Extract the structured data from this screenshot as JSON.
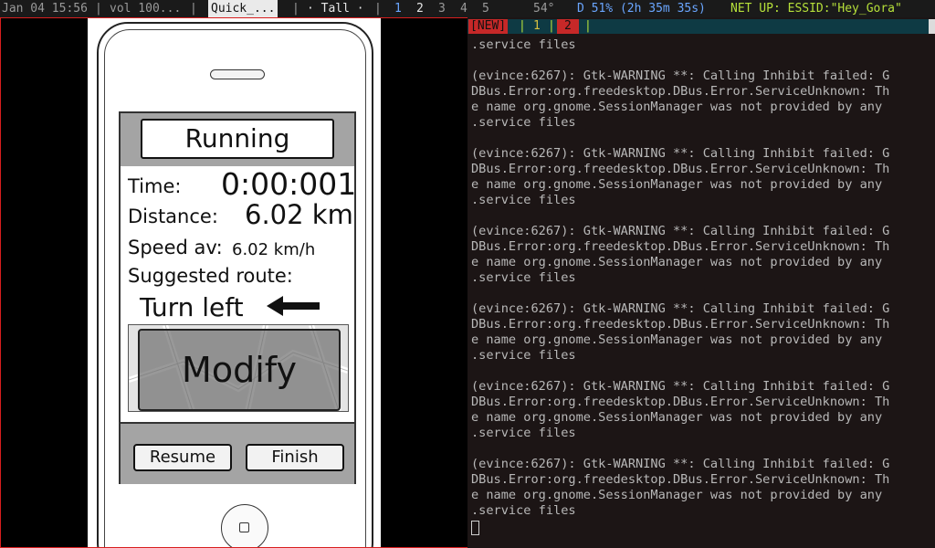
{
  "topbar": {
    "datetime": "Jan 04 15:56",
    "sep_a": "|",
    "volume": "vol 100...",
    "sep_b": "|",
    "active_title": "Quick_...",
    "sep_c": "|",
    "layout": "· Tall ·",
    "sep_d": "|",
    "workspaces": [
      "1",
      "2",
      "3",
      "4",
      "5"
    ],
    "temperature": "54°",
    "battery": "D 51% (2h 35m 35s)",
    "network": "NET UP: ESSID:\"Hey_Gora\""
  },
  "mockup": {
    "status_title": "Running",
    "time_label": "Time:",
    "time_value": "0:00:001",
    "distance_label": "Distance:",
    "distance_value": "6.02 km",
    "speed_label": "Speed av:",
    "speed_value": "6.02 km/h",
    "route_label": "Suggested route:",
    "route_instruction": "Turn left",
    "modify_label": "Modify",
    "resume_label": "Resume",
    "finish_label": "Finish"
  },
  "terminal": {
    "tabs": [
      "[NEW]",
      "1",
      "2"
    ],
    "separators": [
      "|",
      "|",
      "|"
    ],
    "lines": [
      ".service files",
      "",
      "(evince:6267): Gtk-WARNING **: Calling Inhibit failed: G",
      "DBus.Error:org.freedesktop.DBus.Error.ServiceUnknown: Th",
      "e name org.gnome.SessionManager was not provided by any",
      ".service files",
      "",
      "(evince:6267): Gtk-WARNING **: Calling Inhibit failed: G",
      "DBus.Error:org.freedesktop.DBus.Error.ServiceUnknown: Th",
      "e name org.gnome.SessionManager was not provided by any",
      ".service files",
      "",
      "(evince:6267): Gtk-WARNING **: Calling Inhibit failed: G",
      "DBus.Error:org.freedesktop.DBus.Error.ServiceUnknown: Th",
      "e name org.gnome.SessionManager was not provided by any",
      ".service files",
      "",
      "(evince:6267): Gtk-WARNING **: Calling Inhibit failed: G",
      "DBus.Error:org.freedesktop.DBus.Error.ServiceUnknown: Th",
      "e name org.gnome.SessionManager was not provided by any",
      ".service files",
      "",
      "(evince:6267): Gtk-WARNING **: Calling Inhibit failed: G",
      "DBus.Error:org.freedesktop.DBus.Error.ServiceUnknown: Th",
      "e name org.gnome.SessionManager was not provided by any",
      ".service files",
      "",
      "(evince:6267): Gtk-WARNING **: Calling Inhibit failed: G",
      "DBus.Error:org.freedesktop.DBus.Error.ServiceUnknown: Th",
      "e name org.gnome.SessionManager was not provided by any",
      ".service files"
    ]
  },
  "colors": {
    "window_border": "#d81e1e",
    "terminal_bg": "#1c1515",
    "tmux_bar": "#0e3a44",
    "tab_active": "#c62828",
    "workspace_current": "#e6e6e6",
    "workspace_other": "#9a9a9a",
    "workspace_first": "#6aa6ff",
    "network_text": "#b6e03a"
  }
}
